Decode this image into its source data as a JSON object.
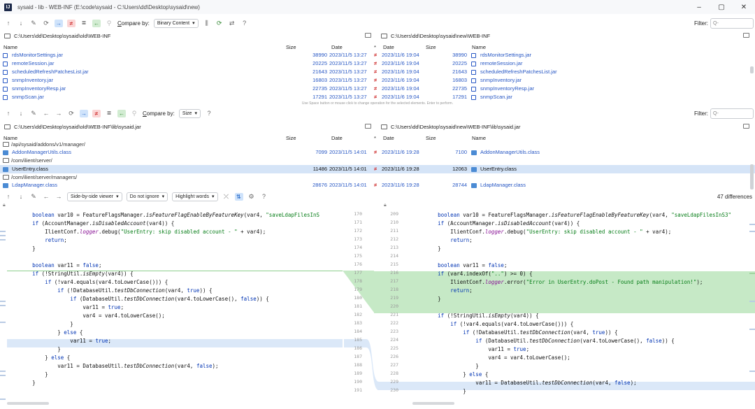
{
  "window": {
    "title": "sysaid - lib - WEB-INF (E:\\code\\sysaid - C:\\Users\\dd\\Desktop\\sysaid\\new)",
    "logo": "IJ",
    "minimize": "–",
    "maximize": "▢",
    "close": "✕"
  },
  "toolbar1": {
    "compare_label_prefix": "C",
    "compare_label_rest": "ompare by:",
    "compare_value": "Binary Content",
    "filter_label": "Filter:",
    "filter_placeholder": "Q-",
    "help": "?"
  },
  "paths1": {
    "left": "C:\\Users\\dd\\Desktop\\sysaid\\old\\WEB-INF",
    "right": "C:\\Users\\dd\\Desktop\\sysaid\\new\\WEB-INF"
  },
  "columns": {
    "name": "Name",
    "size": "Size",
    "date": "Date",
    "star": "*",
    "date2": "Date",
    "size2": "Size",
    "name2": "Name"
  },
  "table1": {
    "rows": [
      {
        "lname": "rdsMonitorSettings.jar",
        "lsize": "38990",
        "ldate": "2023/11/5 13:27",
        "op": "≠",
        "rdate": "2023/11/6 19:04",
        "rsize": "38990",
        "rname": "rdsMonitorSettings.jar"
      },
      {
        "lname": "remoteSession.jar",
        "lsize": "20225",
        "ldate": "2023/11/5 13:27",
        "op": "≠",
        "rdate": "2023/11/6 19:04",
        "rsize": "20225",
        "rname": "remoteSession.jar"
      },
      {
        "lname": "scheduledRefreshPatchesList.jar",
        "lsize": "21643",
        "ldate": "2023/11/5 13:27",
        "op": "≠",
        "rdate": "2023/11/6 19:04",
        "rsize": "21643",
        "rname": "scheduledRefreshPatchesList.jar"
      },
      {
        "lname": "snmpInventory.jar",
        "lsize": "16803",
        "ldate": "2023/11/5 13:27",
        "op": "≠",
        "rdate": "2023/11/6 19:04",
        "rsize": "16803",
        "rname": "snmpInventory.jar"
      },
      {
        "lname": "snmpInventoryResp.jar",
        "lsize": "22735",
        "ldate": "2023/11/5 13:27",
        "op": "≠",
        "rdate": "2023/11/6 19:04",
        "rsize": "22735",
        "rname": "snmpInventoryResp.jar"
      },
      {
        "lname": "snmpScan.jar",
        "lsize": "17291",
        "ldate": "2023/11/5 13:27",
        "op": "≠",
        "rdate": "2023/11/6 19:04",
        "rsize": "17291",
        "rname": "snmpScan.jar"
      }
    ],
    "hint": "Use Space button or mouse click to change operation for the selected elements. Enter to perform."
  },
  "toolbar2": {
    "compare_label_prefix": "C",
    "compare_label_rest": "ompare by:",
    "compare_value": "Size",
    "filter_label": "Filter:",
    "filter_placeholder": "Q-",
    "help": "?"
  },
  "paths2": {
    "left": "C:\\Users\\dd\\Desktop\\sysaid\\old\\WEB-INF\\lib\\sysaid.jar",
    "right": "C:\\Users\\dd\\Desktop\\sysaid\\new\\WEB-INF\\lib\\sysaid.jar"
  },
  "table2": {
    "dir0": "/api/sysaid/addons/v1/manager/",
    "row1": {
      "lname": "AddonManagerUtils.class",
      "lsize": "7099",
      "ldate": "2023/11/5 14:01",
      "op": "≠",
      "rdate": "2023/11/6 19:28",
      "rsize": "7100",
      "rname": "AddonManagerUtils.class"
    },
    "dir1": "/com/ilient/server/",
    "row2": {
      "lname": "UserEntry.class",
      "lsize": "11486",
      "ldate": "2023/11/5 14:01",
      "op": "≠",
      "rdate": "2023/11/6 19:28",
      "rsize": "12063",
      "rname": "UserEntry.class"
    },
    "dir2": "/com/ilient/server/managers/",
    "row3": {
      "lname": "LdapManager.class",
      "lsize": "28676",
      "ldate": "2023/11/5 14:01",
      "op": "≠",
      "rdate": "2023/11/6 19:28",
      "rsize": "28744",
      "rname": "LdapManager.class"
    }
  },
  "toolbar3": {
    "viewer": "Side-by-side viewer",
    "ignore": "Do not ignore",
    "highlight": "Highlight words",
    "help": "?",
    "diff_count": "47 differences"
  },
  "left_lines": [
    "170",
    "171",
    "172",
    "173",
    "174",
    "175",
    "176",
    "177",
    "178",
    "179",
    "180",
    "181",
    "182",
    "183",
    "184",
    "185",
    "186",
    "187",
    "188",
    "189",
    "190",
    "191"
  ],
  "right_lines": [
    "209",
    "210",
    "211",
    "212",
    "213",
    "214",
    "215",
    "216",
    "217",
    "218",
    "219",
    "220",
    "221",
    "222",
    "223",
    "224",
    "225",
    "226",
    "227",
    "228",
    "229",
    "230"
  ],
  "code_left": [
    "        boolean var10 = FeatureFlagsManager.isFeatureFlagEnableByFeatureKey(var4, \"saveLdapFilesInS",
    "        if (AccountManager.isDisabledAccount(var4)) {",
    "            IlientConf.logger.debug(\"UserEntry: skip disabled account - \" + var4);",
    "            return;",
    "        }",
    "",
    "        boolean var11 = false;",
    "        if (!StringUtil.isEmpty(var4)) {",
    "            if (!var4.equals(var4.toLowerCase())) {",
    "                if (!DatabaseUtil.testDbConnection(var4, true)) {",
    "                    if (DatabaseUtil.testDbConnection(var4.toLowerCase(), false)) {",
    "                        var11 = true;",
    "                        var4 = var4.toLowerCase();",
    "                    }",
    "                } else {",
    "                    var11 = true;",
    "                }",
    "            } else {",
    "                var11 = DatabaseUtil.testDbConnection(var4, false);",
    "            }",
    "        }",
    ""
  ],
  "code_right": [
    "        boolean var10 = FeatureFlagsManager.isFeatureFlagEnableByFeatureKey(var4, \"saveLdapFilesInS3\"",
    "        if (AccountManager.isDisabledAccount(var4)) {",
    "            IlientConf.logger.debug(\"UserEntry: skip disabled account - \" + var4);",
    "            return;",
    "        }",
    "",
    "        boolean var11 = false;",
    "        if (var4.indexOf(\"..\") >= 0) {",
    "            IlientConf.logger.error(\"Error in UserEntry.doPost - Found path manipulation!\");",
    "            return;",
    "        }",
    "",
    "        if (!StringUtil.isEmpty(var4)) {",
    "            if (!var4.equals(var4.toLowerCase())) {",
    "                if (!DatabaseUtil.testDbConnection(var4, true)) {",
    "                    if (DatabaseUtil.testDbConnection(var4.toLowerCase(), false)) {",
    "                        var11 = true;",
    "                        var4 = var4.toLowerCase();",
    "                    }",
    "                } else {",
    "                    var11 = DatabaseUtil.testDbConnection(var4, false);",
    "                }"
  ],
  "colors": {
    "accent_blue": "#2757c4",
    "diff_red": "#d23b3b",
    "insert_green": "#c6e9c6",
    "modified_blue": "#dbe8f8",
    "selected_row": "#d5e4f7"
  }
}
